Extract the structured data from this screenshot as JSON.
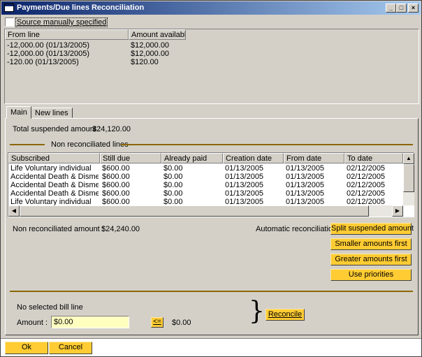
{
  "window": {
    "title": "Payments/Due lines Reconciliation"
  },
  "source_checkbox": {
    "label": "Source manually specified"
  },
  "top_table": {
    "columns": [
      "From line",
      "Amount available"
    ],
    "rows": [
      [
        "-12,000.00 (01/13/2005)",
        "$12,000.00"
      ],
      [
        "-12,000.00 (01/13/2005)",
        "$12,000.00"
      ],
      [
        "-120.00 (01/13/2005)",
        "$120.00"
      ]
    ]
  },
  "tabs": [
    "Main",
    "New lines"
  ],
  "main": {
    "total_suspended_label": "Total suspended amount :",
    "total_suspended_value": "$24,120.00",
    "non_reconciled_title": "Non reconciliated lines",
    "grid": {
      "columns": [
        "Subscribed",
        "Still due",
        "Already paid",
        "Creation date",
        "From date",
        "To date"
      ],
      "rows": [
        [
          "Life Voluntary individual",
          "$600.00",
          "$0.00",
          "01/13/2005",
          "01/13/2005",
          "02/12/2005"
        ],
        [
          "Accidental Death & Dismem…",
          "$600.00",
          "$0.00",
          "01/13/2005",
          "01/13/2005",
          "02/12/2005"
        ],
        [
          "Accidental Death & Dismem…",
          "$600.00",
          "$0.00",
          "01/13/2005",
          "01/13/2005",
          "02/12/2005"
        ],
        [
          "Accidental Death & Dismem…",
          "$600.00",
          "$0.00",
          "01/13/2005",
          "01/13/2005",
          "02/12/2005"
        ],
        [
          "Life Voluntary individual",
          "$600.00",
          "$0.00",
          "01/13/2005",
          "01/13/2005",
          "02/12/2005"
        ]
      ]
    },
    "non_reconciled_amount_label": "Non reconciliated amount :",
    "non_reconciled_amount_value": "$24,240.00",
    "auto_reconciliation_label": "Automatic reconciliation :",
    "auto_buttons": [
      "Split suspended amount",
      "Smaller amounts first",
      "Greater amounts first",
      "Use priorities"
    ],
    "no_bill_line": "No selected bill line",
    "amount_label": "Amount :",
    "amount_value": "$0.00",
    "arrow_button": "<=",
    "amount_right_value": "$0.00",
    "reconcile_button": "Reconcile"
  },
  "footer": {
    "ok": "Ok",
    "cancel": "Cancel"
  },
  "colors": {
    "accent_button": "#ffcc33",
    "input_bg": "#ffffc0",
    "title_start": "#0a246a",
    "title_end": "#a6caf0"
  }
}
